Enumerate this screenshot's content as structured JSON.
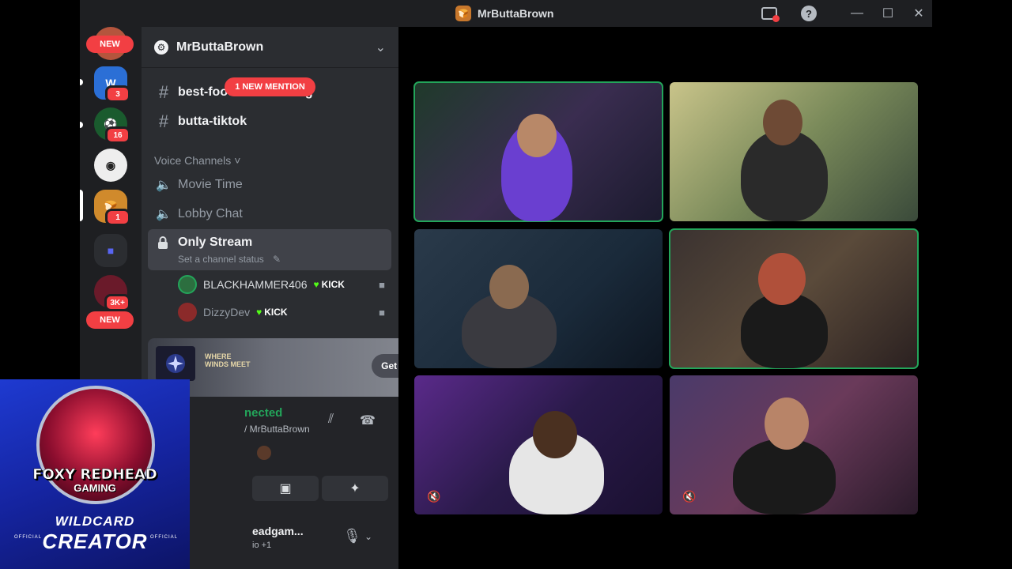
{
  "window": {
    "title": "MrButtaBrown",
    "icons": [
      "record-icon",
      "help-icon",
      "minimize-icon",
      "maximize-icon",
      "close-icon"
    ]
  },
  "servers": {
    "new_top": "NEW",
    "items": [
      {
        "name": "server-w",
        "badge": "3"
      },
      {
        "name": "server-green",
        "badge": "16"
      },
      {
        "name": "server-ninja",
        "badge": ""
      },
      {
        "name": "server-mrbuttabrown",
        "badge": "1"
      },
      {
        "name": "server-folder",
        "badge": ""
      },
      {
        "name": "server-avatar",
        "badge": "3K+"
      }
    ],
    "new_bottom": "NEW"
  },
  "sidebar": {
    "guild_name": "MrButtaBrown",
    "mention_pill": "1 NEW MENTION",
    "text_channels": [
      {
        "label": "best-food",
        "suffix": "g"
      },
      {
        "label": "butta-tiktok"
      }
    ],
    "voice_category": "Voice Channels",
    "voice_channels": [
      {
        "label": "Movie Time"
      },
      {
        "label": "Lobby Chat"
      }
    ],
    "active_channel": {
      "label": "Only Stream",
      "status": "Set a channel status"
    },
    "members": [
      {
        "name": "BLACKHAMMER406",
        "tag": "KICK"
      },
      {
        "name": "DizzyDev",
        "tag": "KICK"
      }
    ]
  },
  "promo": {
    "logo_line1": "WHERE",
    "logo_line2": "WINDS MEET",
    "button": "Get Reward!"
  },
  "voice_panel": {
    "status": "nected",
    "channel": "/ MrButtaBrown"
  },
  "user_panel": {
    "name": "eadgam...",
    "sub": "io +1"
  },
  "overlay": {
    "brand_line1": "FOXY REDHEAD",
    "brand_line2": "GAMING",
    "tag_line1": "WILDCARD",
    "tag_line2": "CREATOR",
    "official": "OFFICIAL"
  },
  "colors": {
    "speaking": "#23a55a",
    "badge": "#f23f43",
    "kick": "#53fc18",
    "accent": "#5865f2"
  }
}
